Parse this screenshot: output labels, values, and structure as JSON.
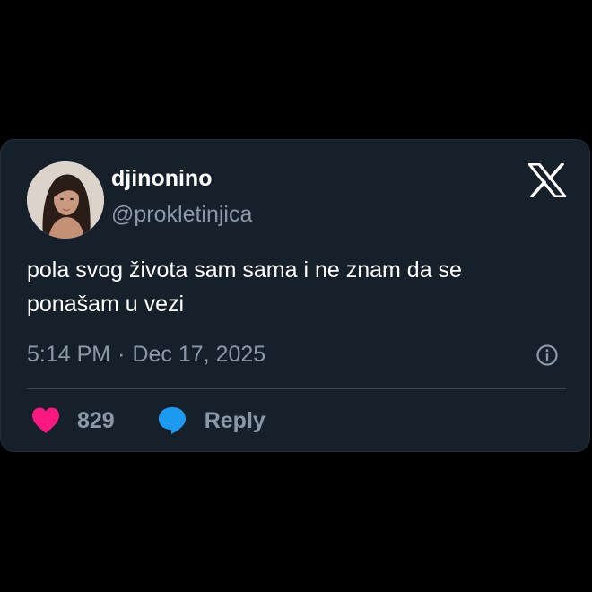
{
  "author": {
    "display_name": "djinonino",
    "handle": "@prokletinjica"
  },
  "tweet": {
    "text_line1": "pola svog života sam sama i ne znam da se",
    "text_line2": "ponašam u vezi",
    "time": "5:14 PM",
    "separator": "·",
    "date": "Dec 17, 2025"
  },
  "actions": {
    "like_count": "829",
    "reply_label": "Reply"
  },
  "icons": {
    "logo": "x-logo-icon",
    "info": "info-icon",
    "like": "heart-icon",
    "reply": "speech-bubble-icon"
  },
  "colors": {
    "background": "#000000",
    "card": "#15202b",
    "primary_text": "#ffffff",
    "secondary_text": "#8b98a5",
    "heart": "#f91880",
    "reply": "#1d9bf0"
  }
}
